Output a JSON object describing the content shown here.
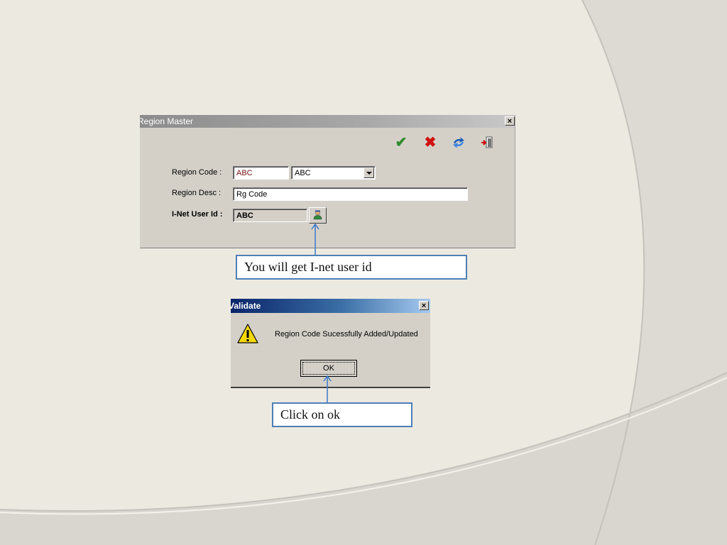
{
  "region_window": {
    "title": "Region Master",
    "close_label": "×",
    "toolbar": {
      "ok_icon": "checkmark-icon",
      "cancel_icon": "cross-icon",
      "refresh_icon": "refresh-icon",
      "exit_icon": "exit-door-icon"
    },
    "region_code_label": "Region Code :",
    "region_code_value": "ABC",
    "region_combo_value": "ABC",
    "region_desc_label": "Region Desc :",
    "region_desc_value": "Rg Code",
    "user_id_label": "I-Net  User Id :",
    "user_id_value": "ABC"
  },
  "callouts": {
    "user_id_note": "You will get I-net user id",
    "ok_note": "Click on ok"
  },
  "validate_dialog": {
    "title": "Validate",
    "close_label": "×",
    "message": "Region Code Sucessfully Added/Updated",
    "ok_label": "OK"
  },
  "colors": {
    "slide_background": "#eceae0",
    "callout_border": "#4d7fb8",
    "dialog_title_bar": "#0a246a",
    "window_face": "#d4d0c8"
  }
}
